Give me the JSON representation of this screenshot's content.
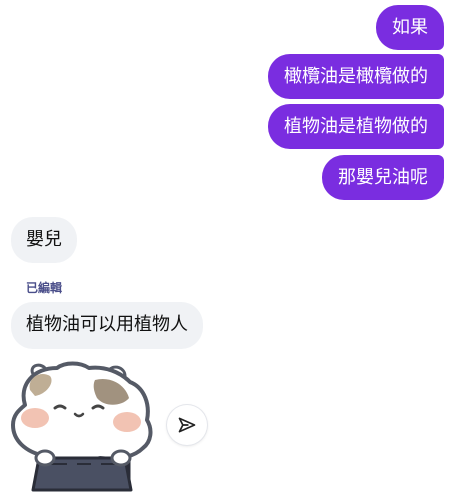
{
  "messages": {
    "outgoing": [
      {
        "text": "如果"
      },
      {
        "text": "橄欖油是橄欖做的"
      },
      {
        "text": "植物油是植物做的"
      },
      {
        "text": "那嬰兒油呢"
      }
    ],
    "incoming": [
      {
        "text": "嬰兒"
      },
      {
        "text": "植物油可以用植物人",
        "edited_label": "已編輯"
      }
    ]
  },
  "sticker": {
    "icon": "hamster-sticker"
  },
  "share_button": {
    "icon": "send-icon"
  },
  "colors": {
    "outgoing_bubble": "#7a2de0",
    "incoming_bubble": "#f0f2f5",
    "edited_label": "#4a4e8a"
  }
}
